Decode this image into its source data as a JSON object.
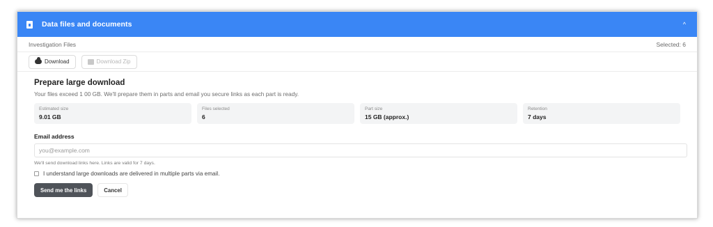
{
  "panel": {
    "title": "Data files and documents",
    "collapse_glyph": "^",
    "header_icon": "file-icon"
  },
  "files": {
    "heading": "Investigation Files",
    "selected_prefix": "Selected: ",
    "selected_count": "6"
  },
  "toolbar": {
    "download_label": "Download",
    "download_icon": "cloud-download-icon",
    "download_zip_label": "Download Zip",
    "download_zip_icon": "zip-icon"
  },
  "prepare": {
    "title": "Prepare large download",
    "description": "Your files exceed 1 00 GB. We'll prepare them in parts and email you secure links as each part is ready.",
    "stats": [
      {
        "label": "Estimated size",
        "value": "9.01 GB"
      },
      {
        "label": "Files selected",
        "value": "6"
      },
      {
        "label": "Part size",
        "value": "15 GB (approx.)"
      },
      {
        "label": "Retention",
        "value": "7 days"
      }
    ]
  },
  "email": {
    "label": "Email address",
    "placeholder": "you@example.com",
    "hint": "We'll send download links here. Links are valid for 7 days."
  },
  "consent": {
    "label": "I understand large downloads are delivered in multiple parts via email."
  },
  "actions": {
    "submit_label": "Send me the links",
    "cancel_label": "Cancel"
  },
  "colors": {
    "header_bg": "#3a86f5",
    "primary_button": "#4f5359"
  }
}
